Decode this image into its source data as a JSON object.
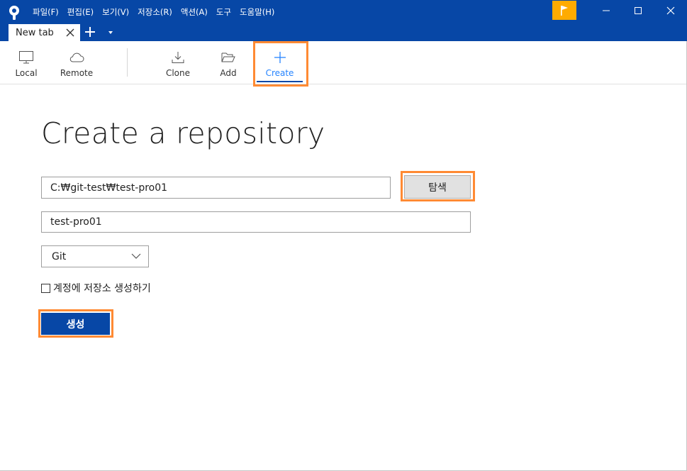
{
  "menu": [
    "파일(F)",
    "편집(E)",
    "보기(V)",
    "저장소(R)",
    "액션(A)",
    "도구",
    "도움말(H)"
  ],
  "tab": {
    "label": "New tab"
  },
  "toolbar": {
    "local": "Local",
    "remote": "Remote",
    "clone": "Clone",
    "add": "Add",
    "create": "Create"
  },
  "page": {
    "title": "Create a repository"
  },
  "form": {
    "path_value": "C:₩git-test₩test-pro01",
    "browse_label": "탐색",
    "name_value": "test-pro01",
    "vcs_selected": "Git",
    "account_checkbox_label": "계정에 저장소 생성하기",
    "account_checkbox_checked": false,
    "create_button_label": "생성"
  },
  "colors": {
    "brand": "#0747a6",
    "accent": "#2684ff",
    "flag": "#ffab00",
    "highlight": "#ff8a33"
  },
  "icons": {
    "app": "sourcetree-logo",
    "local": "monitor-icon",
    "remote": "cloud-icon",
    "clone": "download-icon",
    "add": "folder-open-icon",
    "create": "plus-icon"
  }
}
